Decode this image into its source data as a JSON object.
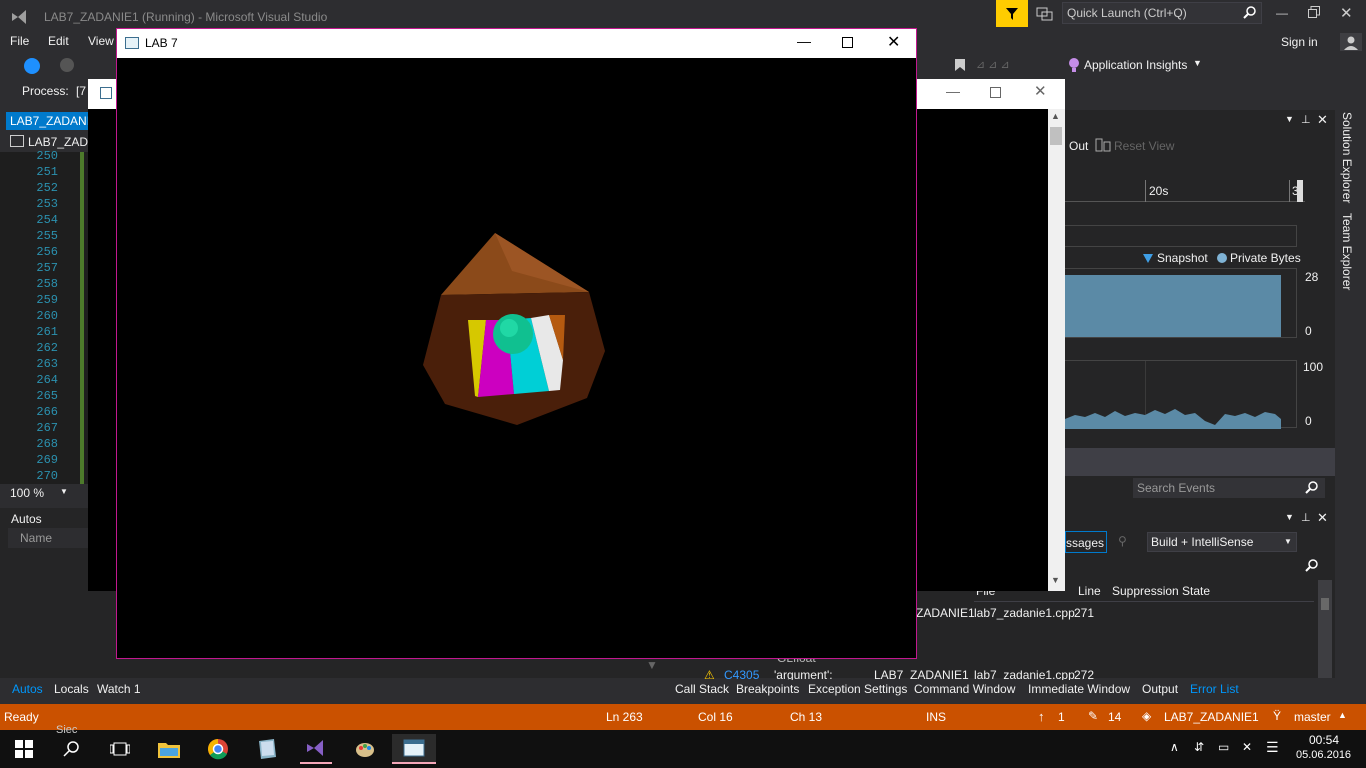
{
  "vs": {
    "title": "LAB7_ZADANIE1 (Running) - Microsoft Visual Studio",
    "quick_launch_placeholder": "Quick Launch (Ctrl+Q)",
    "sign_in": "Sign in",
    "menu": [
      "File",
      "Edit",
      "View"
    ],
    "app_insights": "Application Insights",
    "process_label": "Process:",
    "process_value": "[7",
    "tab_file": "LAB7_ZADANI",
    "tab_scope": "LAB7_ZADA",
    "zoom": "100 %",
    "line_numbers": [
      "250",
      "251",
      "252",
      "253",
      "254",
      "255",
      "256",
      "257",
      "258",
      "259",
      "260",
      "261",
      "262",
      "263",
      "264",
      "265",
      "266",
      "267",
      "268",
      "269",
      "270"
    ]
  },
  "autos": {
    "title": "Autos",
    "col_name": "Name",
    "tabs": [
      "Autos",
      "Locals",
      "Watch 1"
    ]
  },
  "diagnostics": {
    "out_label": "Out",
    "reset_view": "Reset View",
    "timeline_20s": "20s",
    "timeline_3": "3",
    "snapshot": "Snapshot",
    "private_bytes": "Private Bytes",
    "mem_max": "28",
    "mem_min": "0",
    "cpu_max": "100",
    "cpu_min": "0",
    "search_events_placeholder": "Search Events"
  },
  "errorlist": {
    "messages_label": "ssages",
    "build_filter": "Build + IntelliSense",
    "col_file": "File",
    "col_line": "Line",
    "col_suppression": "Suppression State",
    "row1_project": "ZADANIE1",
    "row1_file": "lab7_zadanie1.cpp",
    "row1_line": "271",
    "row2_code": "C4305",
    "row2_desc": "'argument':",
    "row2_project": "LAB7_ZADANIE1",
    "row2_file": "lab7_zadanie1.cpp",
    "row2_line": "272",
    "partial_text": "GLfloat",
    "bottom_tabs": [
      "Call Stack",
      "Breakpoints",
      "Exception Settings",
      "Command Window",
      "Immediate Window",
      "Output",
      "Error List"
    ]
  },
  "side_tabs": [
    "Solution Explorer",
    "Team Explorer"
  ],
  "status": {
    "ready": "Ready",
    "ln": "Ln 263",
    "col": "Col 16",
    "ch": "Ch 13",
    "ins": "INS",
    "up_count": "1",
    "edit_count": "14",
    "repo": "LAB7_ZADANIE1",
    "branch": "master"
  },
  "lab": {
    "title": "LAB 7"
  },
  "taskbar": {
    "time": "00:54",
    "date": "05.06.2016",
    "behind_text": "Siec"
  },
  "colors": {
    "vs_accent": "#007acc",
    "status_bar": "#ca5100",
    "lab_border": "#c2188f",
    "filter_yellow": "#ffcc00"
  }
}
